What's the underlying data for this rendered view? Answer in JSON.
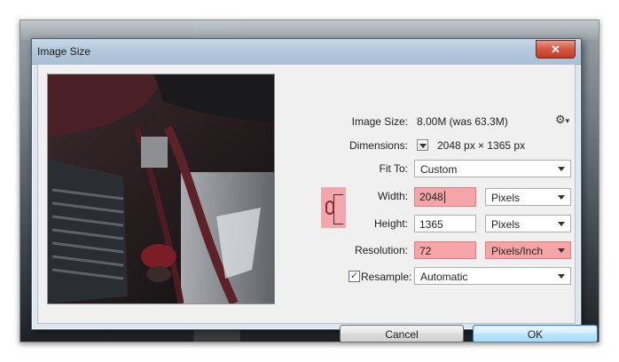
{
  "dialog": {
    "title": "Image Size",
    "close_glyph": "✕"
  },
  "info": {
    "image_size_label": "Image Size:",
    "image_size_value": "8.00M (was 63.3M)",
    "dimensions_label": "Dimensions:",
    "dimensions_value": "2048 px  ×  1365 px"
  },
  "fit_to": {
    "label": "Fit To:",
    "value": "Custom"
  },
  "width": {
    "label": "Width:",
    "value": "2048",
    "unit": "Pixels"
  },
  "height": {
    "label": "Height:",
    "value": "1365",
    "unit": "Pixels"
  },
  "resolution": {
    "label": "Resolution:",
    "value": "72",
    "unit": "Pixels/Inch"
  },
  "resample": {
    "label": "Resample:",
    "checked": true,
    "value": "Automatic"
  },
  "buttons": {
    "cancel": "Cancel",
    "ok": "OK"
  },
  "icons": {
    "settings": "gear-icon",
    "link": "chain-link-icon",
    "dropdown": "chevron-down-icon",
    "close": "close-icon"
  },
  "colors": {
    "highlight": "#f5a5a8",
    "close_button": "#c23b22",
    "ok_button_border": "#3c7fb1"
  }
}
